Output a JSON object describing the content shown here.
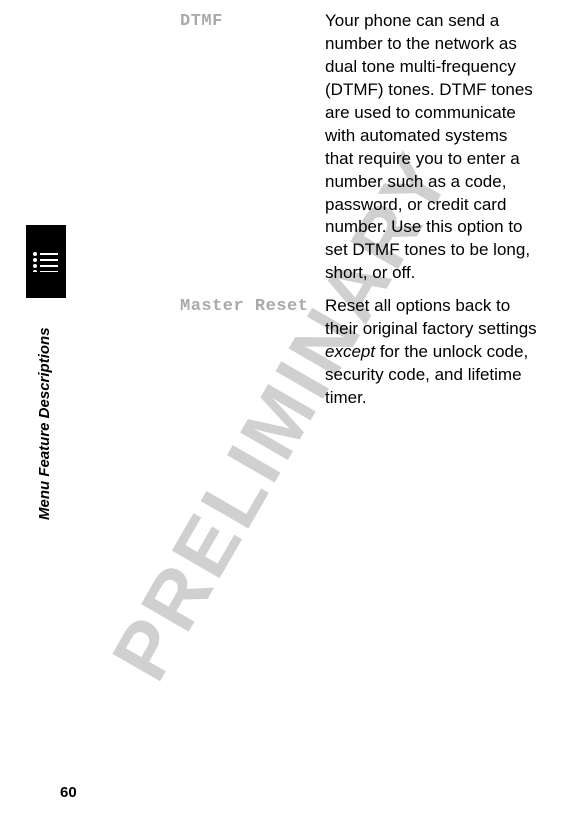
{
  "watermark": "PRELIMINARY",
  "vertical_label": "Menu Feature Descriptions",
  "items": [
    {
      "term": "DTMF",
      "desc_html": "Your phone can send a number to the network as dual tone multi-frequency (DTMF) tones. DTMF tones are used to communicate with automated systems that require you to enter a number such as a code, password, or credit card number. Use this option to set DTMF tones to be long, short, or off."
    },
    {
      "term": "Master Reset",
      "desc_html": "Reset all options back to their original factory settings <em>except</em> for the unlock code, security code, and lifetime timer."
    }
  ],
  "page_number": "60"
}
